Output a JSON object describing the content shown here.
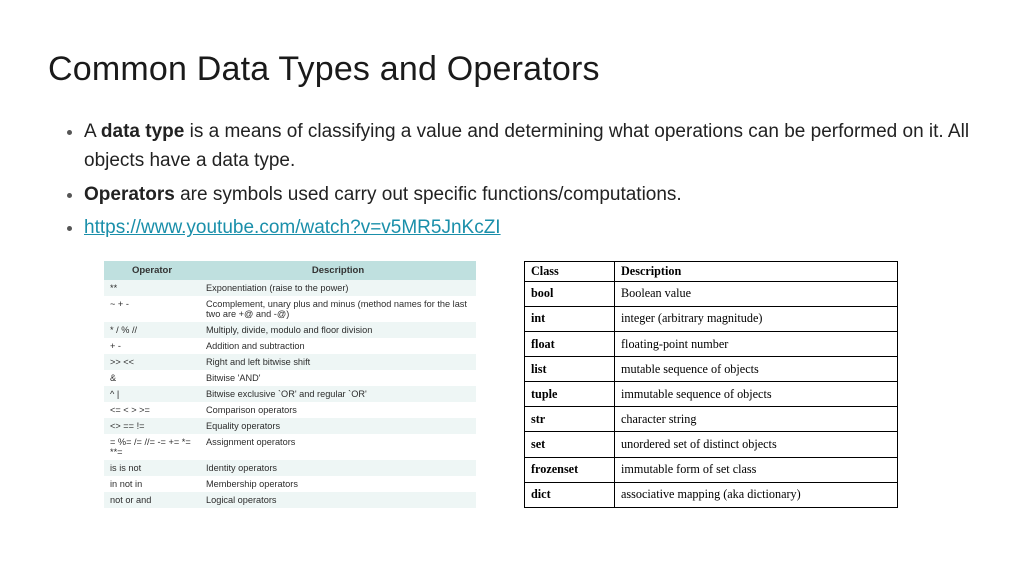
{
  "title": "Common Data Types and Operators",
  "bullets": {
    "b1_before": "A ",
    "b1_bold": "data type",
    "b1_after": " is a means of classifying a value and determining what operations can be performed on it. All objects have a data type.",
    "b2_bold": "Operators",
    "b2_after": " are symbols used carry out specific functions/computations.",
    "link": "https://www.youtube.com/watch?v=v5MR5JnKcZI"
  },
  "op_table": {
    "headers": {
      "op": "Operator",
      "desc": "Description"
    },
    "rows": [
      {
        "op": "**",
        "desc": "Exponentiation (raise to the power)"
      },
      {
        "op": "~ + -",
        "desc": "Ccomplement, unary plus and minus (method names for the last two are +@ and -@)"
      },
      {
        "op": "* / % //",
        "desc": "Multiply, divide, modulo and floor division"
      },
      {
        "op": "+ -",
        "desc": "Addition and subtraction"
      },
      {
        "op": ">> <<",
        "desc": "Right and left bitwise shift"
      },
      {
        "op": "&",
        "desc": "Bitwise 'AND'"
      },
      {
        "op": "^ |",
        "desc": "Bitwise exclusive `OR' and regular `OR'"
      },
      {
        "op": "<= < > >=",
        "desc": "Comparison operators"
      },
      {
        "op": "<> == !=",
        "desc": "Equality operators"
      },
      {
        "op": "= %= /= //= -= += *= **=",
        "desc": "Assignment operators"
      },
      {
        "op": "is is not",
        "desc": "Identity operators"
      },
      {
        "op": "in not in",
        "desc": "Membership operators"
      },
      {
        "op": "not or and",
        "desc": "Logical operators"
      }
    ]
  },
  "cls_table": {
    "headers": {
      "cls": "Class",
      "desc": "Description"
    },
    "rows": [
      {
        "cls": "bool",
        "desc": "Boolean value"
      },
      {
        "cls": "int",
        "desc": "integer (arbitrary magnitude)"
      },
      {
        "cls": "float",
        "desc": "floating-point number"
      },
      {
        "cls": "list",
        "desc": "mutable sequence of objects"
      },
      {
        "cls": "tuple",
        "desc": "immutable sequence of objects"
      },
      {
        "cls": "str",
        "desc": "character string"
      },
      {
        "cls": "set",
        "desc": "unordered set of distinct objects"
      },
      {
        "cls": "frozenset",
        "desc": "immutable form of set class"
      },
      {
        "cls": "dict",
        "desc": "associative mapping (aka dictionary)"
      }
    ]
  }
}
